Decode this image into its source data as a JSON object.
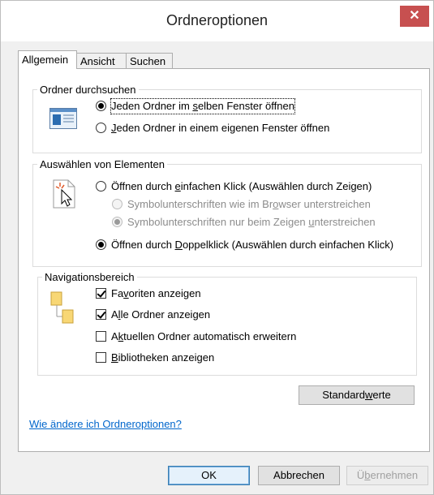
{
  "window": {
    "title": "Ordneroptionen",
    "close_glyph": "✕"
  },
  "tabs": [
    {
      "label": "Allgemein",
      "active": true
    },
    {
      "label": "Ansicht",
      "active": false
    },
    {
      "label": "Suchen",
      "active": false
    }
  ],
  "browse": {
    "legend": "Ordner durchsuchen",
    "icon": "folder-window-icon",
    "opt1": {
      "pre": "Jeden Ordner im ",
      "acc": "s",
      "post": "elben Fenster öffnen",
      "checked": true
    },
    "opt2": {
      "pre": "",
      "acc": "J",
      "post": "eden Ordner in einem eigenen Fenster öffnen",
      "checked": false
    }
  },
  "click": {
    "legend": "Auswählen von Elementen",
    "icon": "pointer-click-icon",
    "single": {
      "pre": "Öffnen durch ",
      "acc": "e",
      "post": "infachen Klick (Auswählen durch Zeigen)",
      "checked": false
    },
    "sub1": {
      "pre": "Symbolunterschriften wie im Br",
      "acc": "o",
      "post": "wser unterstreichen",
      "checked": false
    },
    "sub2": {
      "pre": "Symbolunterschriften nur beim Zeigen ",
      "acc": "u",
      "post": "nterstreichen",
      "checked": true
    },
    "double": {
      "pre": "Öffnen durch ",
      "acc": "D",
      "post": "oppelklick (Auswählen durch einfachen Klick)",
      "checked": true
    }
  },
  "nav": {
    "legend": "Navigationsbereich",
    "icon": "navigation-pane-icon",
    "favorites": {
      "pre": "Fa",
      "acc": "v",
      "post": "oriten anzeigen",
      "checked": true
    },
    "all_folders": {
      "pre": "A",
      "acc": "l",
      "post": "le Ordner anzeigen",
      "checked": true
    },
    "expand": {
      "pre": "A",
      "acc": "k",
      "post": "tuellen Ordner automatisch erweitern",
      "checked": false
    },
    "libraries": {
      "pre": "",
      "acc": "B",
      "post": "ibliotheken anzeigen",
      "checked": false
    }
  },
  "defaults_button": {
    "pre": "Standard",
    "acc": "w",
    "post": "erte"
  },
  "help_link": "Wie ändere ich Ordneroptionen?",
  "buttons": {
    "ok": "OK",
    "cancel": "Abbrechen",
    "apply": {
      "pre": "Ü",
      "acc": "b",
      "post": "ernehmen"
    }
  },
  "colors": {
    "close": "#c75050",
    "link": "#0066cc",
    "default_button_border": "#3c7fb1"
  }
}
